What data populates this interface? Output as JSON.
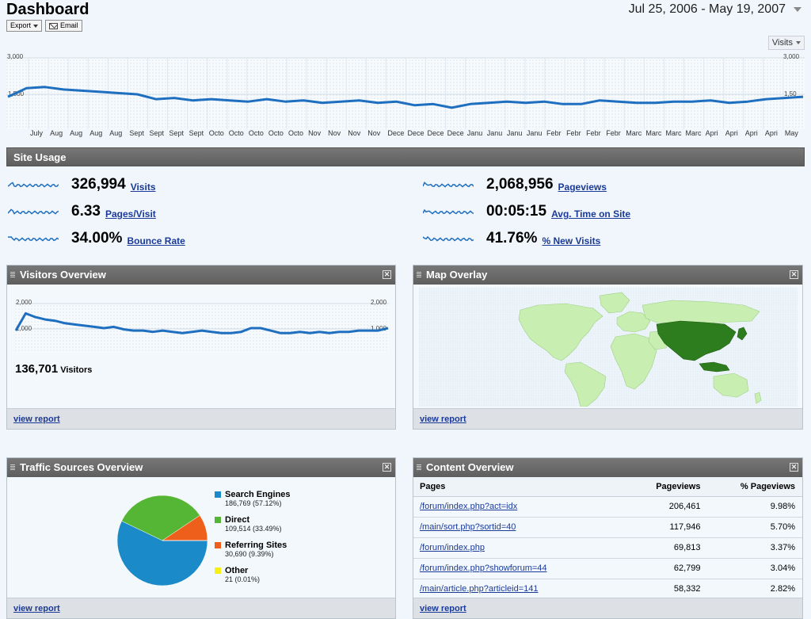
{
  "header": {
    "title": "Dashboard",
    "export_label": "Export",
    "email_label": "Email",
    "date_range": "Jul 25, 2006 - May 19, 2007"
  },
  "main_chart": {
    "metric": "Visits",
    "y_top": "3,000",
    "y_mid": "1,500",
    "y_top_right": "3,000",
    "y_mid_right": "1,50",
    "months": [
      "July",
      "Aug",
      "Aug",
      "Aug",
      "Aug",
      "Sept",
      "Sept",
      "Sept",
      "Sept",
      "Octo",
      "Octo",
      "Octo",
      "Octo",
      "Octo",
      "Nov",
      "Nov",
      "Nov",
      "Nov",
      "Dece",
      "Dece",
      "Dece",
      "Dece",
      "Janu",
      "Janu",
      "Janu",
      "Janu",
      "Febr",
      "Febr",
      "Febr",
      "Febr",
      "Marc",
      "Marc",
      "Marc",
      "Marc",
      "Apri",
      "Apri",
      "Apri",
      "Apri",
      "May"
    ]
  },
  "chart_data": [
    {
      "type": "line",
      "title": "",
      "xlabel": "",
      "ylabel": "",
      "ylim": [
        0,
        3000
      ],
      "x_range": [
        "Jul 25, 2006",
        "May 19, 2007"
      ],
      "series": [
        {
          "name": "Visits",
          "values": [
            1400,
            1750,
            1800,
            1700,
            1650,
            1600,
            1550,
            1500,
            1300,
            1350,
            1250,
            1300,
            1250,
            1200,
            1300,
            1200,
            1250,
            1150,
            1200,
            1250,
            1150,
            1200,
            1050,
            1100,
            950,
            1100,
            1150,
            1200,
            1150,
            1200,
            1100,
            1100,
            1250,
            1200,
            1150,
            1150,
            1200,
            1200,
            1250,
            1150,
            1200,
            1300,
            1350,
            1400
          ]
        }
      ]
    },
    {
      "type": "line",
      "title": "Visitors Overview",
      "ylim": [
        0,
        2000
      ],
      "series": [
        {
          "name": "Visitors",
          "values": [
            900,
            1600,
            1450,
            1350,
            1300,
            1200,
            1150,
            1100,
            1050,
            1000,
            1050,
            950,
            900,
            900,
            850,
            900,
            850,
            800,
            850,
            900,
            850,
            800,
            800,
            850,
            1000,
            1000,
            900,
            800,
            800,
            850,
            800,
            850,
            800,
            850,
            850,
            900,
            900,
            900,
            1000
          ]
        }
      ]
    },
    {
      "type": "pie",
      "title": "Traffic Sources Overview",
      "categories": [
        "Search Engines",
        "Direct",
        "Referring Sites",
        "Other"
      ],
      "values": [
        186769,
        109514,
        30690,
        21
      ],
      "percent": [
        57.12,
        33.49,
        9.39,
        0.01
      ]
    }
  ],
  "site_usage": {
    "title": "Site Usage",
    "metrics": [
      {
        "value": "326,994",
        "label": "Visits"
      },
      {
        "value": "6.33",
        "label": "Pages/Visit"
      },
      {
        "value": "34.00%",
        "label": "Bounce Rate"
      },
      {
        "value": "2,068,956",
        "label": "Pageviews"
      },
      {
        "value": "00:05:15",
        "label": "Avg. Time on Site"
      },
      {
        "value": "41.76%",
        "label": "% New Visits"
      }
    ]
  },
  "visitors_overview": {
    "title": "Visitors Overview",
    "y_top": "2,000",
    "y_mid": "1,000",
    "y_top_right": "2,000",
    "y_mid_right": "1,000",
    "total": "136,701",
    "total_label": "Visitors",
    "view_report": "view report"
  },
  "map_overlay": {
    "title": "Map Overlay",
    "view_report": "view report"
  },
  "traffic_sources": {
    "title": "Traffic Sources Overview",
    "items": [
      {
        "name": "Search Engines",
        "detail": "186,769 (57.12%)",
        "color": "#1b8ac8"
      },
      {
        "name": "Direct",
        "detail": "109,514 (33.49%)",
        "color": "#55b534"
      },
      {
        "name": "Referring Sites",
        "detail": "30,690 (9.39%)",
        "color": "#ef5f1c"
      },
      {
        "name": "Other",
        "detail": "21 (0.01%)",
        "color": "#f4f018"
      }
    ],
    "view_report": "view report"
  },
  "content_overview": {
    "title": "Content Overview",
    "columns": [
      "Pages",
      "Pageviews",
      "% Pageviews"
    ],
    "rows": [
      {
        "page": "/forum/index.php?act=idx",
        "views": "206,461",
        "pct": "9.98%"
      },
      {
        "page": "/main/sort.php?sortid=40",
        "views": "117,946",
        "pct": "5.70%"
      },
      {
        "page": "/forum/index.php",
        "views": "69,813",
        "pct": "3.37%"
      },
      {
        "page": "/forum/index.php?showforum=44",
        "views": "62,799",
        "pct": "3.04%"
      },
      {
        "page": "/main/article.php?articleid=141",
        "views": "58,332",
        "pct": "2.82%"
      }
    ],
    "view_report": "view report"
  },
  "colors": {
    "line": "#1f6fc0",
    "header_bar": "#666666",
    "link": "#1a3a9a",
    "map_highlight": "#2d7d1e",
    "map_light": "#c8efb1"
  }
}
